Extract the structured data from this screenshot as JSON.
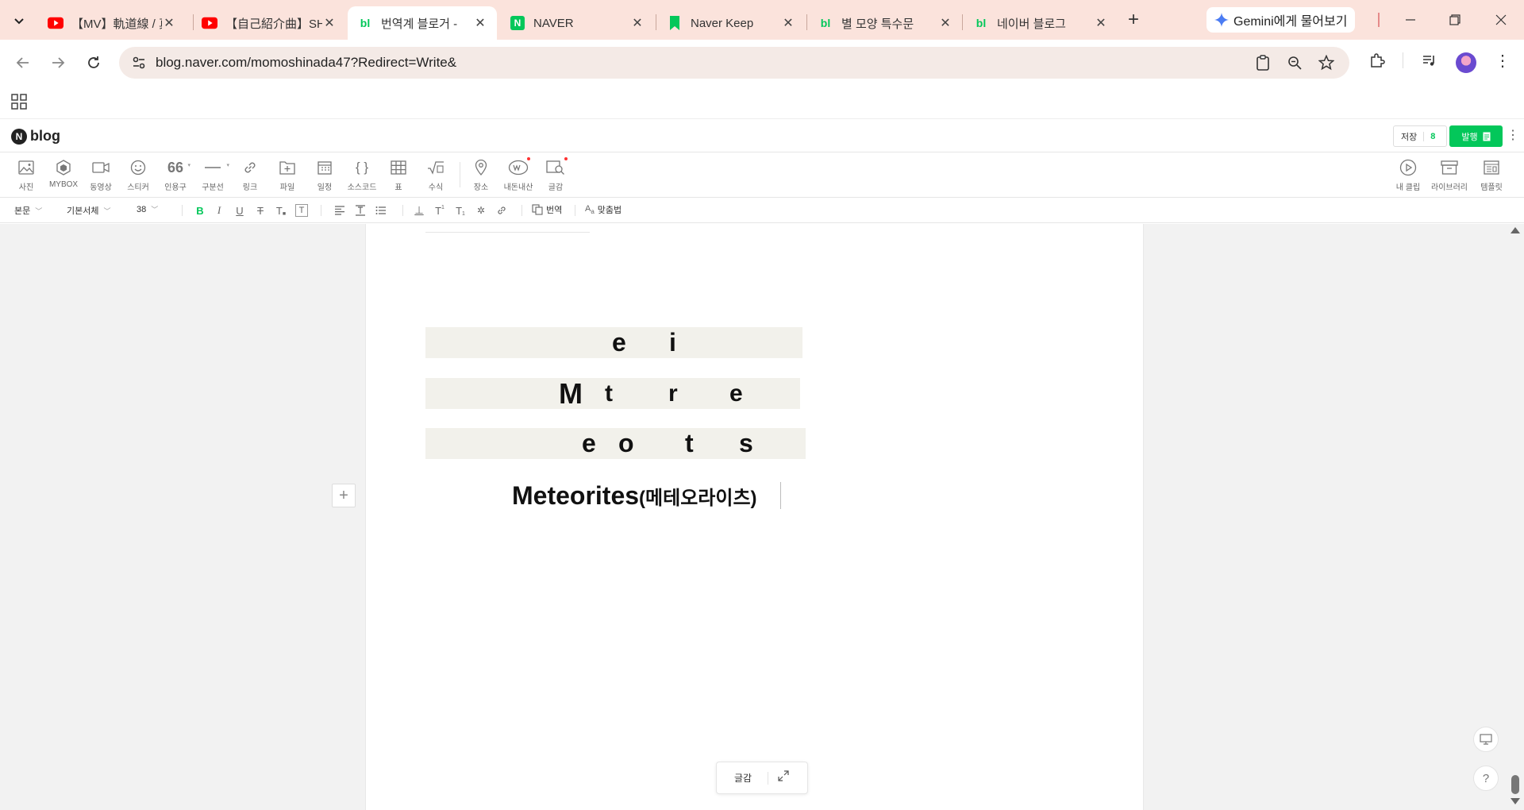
{
  "browser": {
    "tabs": [
      {
        "title": "【MV】軌道線 / 真",
        "icon": "youtube-icon",
        "active": false
      },
      {
        "title": "【自己紹介曲】SH",
        "icon": "youtube-icon",
        "active": false
      },
      {
        "title": "번역계 블로거 -",
        "icon": "naver-blog-icon",
        "active": true
      },
      {
        "title": "NAVER",
        "icon": "naver-icon",
        "active": false
      },
      {
        "title": "Naver Keep",
        "icon": "bookmark-icon",
        "active": false
      },
      {
        "title": "별 모양 특수문",
        "icon": "naver-blog-icon",
        "active": false
      },
      {
        "title": "네이버 블로그",
        "icon": "naver-blog-icon",
        "active": false
      }
    ],
    "gemini_label": "Gemini에게 물어보기",
    "url": "blog.naver.com/momoshinada47?Redirect=Write&"
  },
  "editor": {
    "logo_text": "blog",
    "save_label": "저장",
    "save_count": "8",
    "publish_label": "발행",
    "insert_tools": [
      {
        "label": "사진",
        "icon": "photo-icon"
      },
      {
        "label": "MYBOX",
        "icon": "mybox-icon"
      },
      {
        "label": "동영상",
        "icon": "video-icon"
      },
      {
        "label": "스티커",
        "icon": "sticker-icon"
      },
      {
        "label": "인용구",
        "icon": "quote-icon"
      },
      {
        "label": "구분선",
        "icon": "divider-icon"
      },
      {
        "label": "링크",
        "icon": "link-icon"
      },
      {
        "label": "파일",
        "icon": "file-icon"
      },
      {
        "label": "일정",
        "icon": "calendar-icon"
      },
      {
        "label": "소스코드",
        "icon": "code-icon"
      },
      {
        "label": "표",
        "icon": "table-icon"
      },
      {
        "label": "수식",
        "icon": "formula-icon"
      },
      {
        "label": "장소",
        "icon": "place-icon"
      },
      {
        "label": "내돈내산",
        "icon": "my-money-icon"
      },
      {
        "label": "글감",
        "icon": "material-search-icon"
      }
    ],
    "right_tools": [
      {
        "label": "내 클립",
        "icon": "clip-icon"
      },
      {
        "label": "라이브러리",
        "icon": "library-icon"
      },
      {
        "label": "템플릿",
        "icon": "template-icon"
      }
    ],
    "format": {
      "paragraph_style": "본문",
      "font": "기본서체",
      "size": "38",
      "translate_label": "번역",
      "spellcheck_label": "맞춤법"
    },
    "content": {
      "row1_chars": [
        "e",
        "i"
      ],
      "row2_chars": [
        "M",
        "t",
        "r",
        "e"
      ],
      "row3_chars": [
        "e",
        "o",
        "t",
        "s"
      ],
      "title_en": "Meteorites",
      "title_ko": "(메테오라이츠)"
    },
    "floating_label": "글감",
    "colors": {
      "accent": "#03c75a",
      "tab_bar": "#fbe3dc",
      "highlight": "#f2f1eb"
    }
  }
}
